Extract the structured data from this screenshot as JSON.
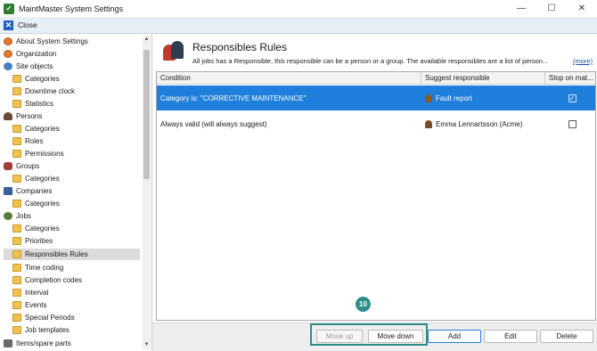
{
  "window": {
    "title": "MaintMaster System Settings",
    "app_icon": "maintmaster-logo-icon",
    "controls": {
      "minimize": "—",
      "maximize": "☐",
      "close": "✕"
    }
  },
  "closebar": {
    "label": "Close"
  },
  "tree": {
    "items": [
      {
        "label": "About System Settings",
        "icon": "gear-icon"
      },
      {
        "label": "Organization",
        "icon": "gear-icon"
      },
      {
        "label": "Site objects",
        "icon": "site-icon"
      },
      {
        "label": "Categories",
        "icon": "folder-icon"
      },
      {
        "label": "Downtime clock",
        "icon": "folder-icon"
      },
      {
        "label": "Statistics",
        "icon": "folder-icon"
      },
      {
        "label": "Persons",
        "icon": "person-icon"
      },
      {
        "label": "Categories",
        "icon": "folder-icon"
      },
      {
        "label": "Roles",
        "icon": "folder-icon"
      },
      {
        "label": "Permissions",
        "icon": "folder-icon"
      },
      {
        "label": "Groups",
        "icon": "group-icon"
      },
      {
        "label": "Categories",
        "icon": "folder-icon"
      },
      {
        "label": "Companies",
        "icon": "company-icon"
      },
      {
        "label": "Categories",
        "icon": "folder-icon"
      },
      {
        "label": "Jobs",
        "icon": "jobs-icon"
      },
      {
        "label": "Categories",
        "icon": "folder-icon"
      },
      {
        "label": "Priorities",
        "icon": "folder-icon"
      },
      {
        "label": "Responsibles Rules",
        "icon": "folder-icon",
        "selected": true
      },
      {
        "label": "Time coding",
        "icon": "folder-icon"
      },
      {
        "label": "Completion codes",
        "icon": "folder-icon"
      },
      {
        "label": "Interval",
        "icon": "folder-icon"
      },
      {
        "label": "Events",
        "icon": "folder-icon"
      },
      {
        "label": "Special Periods",
        "icon": "folder-icon"
      },
      {
        "label": "Job templates",
        "icon": "folder-icon"
      },
      {
        "label": "Items/spare parts",
        "icon": "items-icon"
      }
    ]
  },
  "header": {
    "title": "Responsibles Rules",
    "description": "All jobs has a Responsible, this responsible can be a person or a group. The available responsibles are a list of person...",
    "more_link": "(more)"
  },
  "grid": {
    "columns": [
      "Condition",
      "Suggest responsible",
      "Stop on mat..."
    ],
    "rows": [
      {
        "condition": "Category is: \"CORRECTIVE MAINTENANCE\"",
        "responsible": "Fault report",
        "stop": true,
        "selected": true
      },
      {
        "condition": "Always valid (will always suggest)",
        "responsible": "Emma Lennartsson (Acme)",
        "stop": false,
        "selected": false
      }
    ]
  },
  "step_badge": "10",
  "buttons": {
    "move_up": "Move up",
    "move_down": "Move down",
    "add": "Add",
    "edit": "Edit",
    "delete": "Delete"
  },
  "colors": {
    "selection": "#1f7fdc",
    "highlight": "#2e8f8a",
    "link": "#1a4fa8"
  }
}
